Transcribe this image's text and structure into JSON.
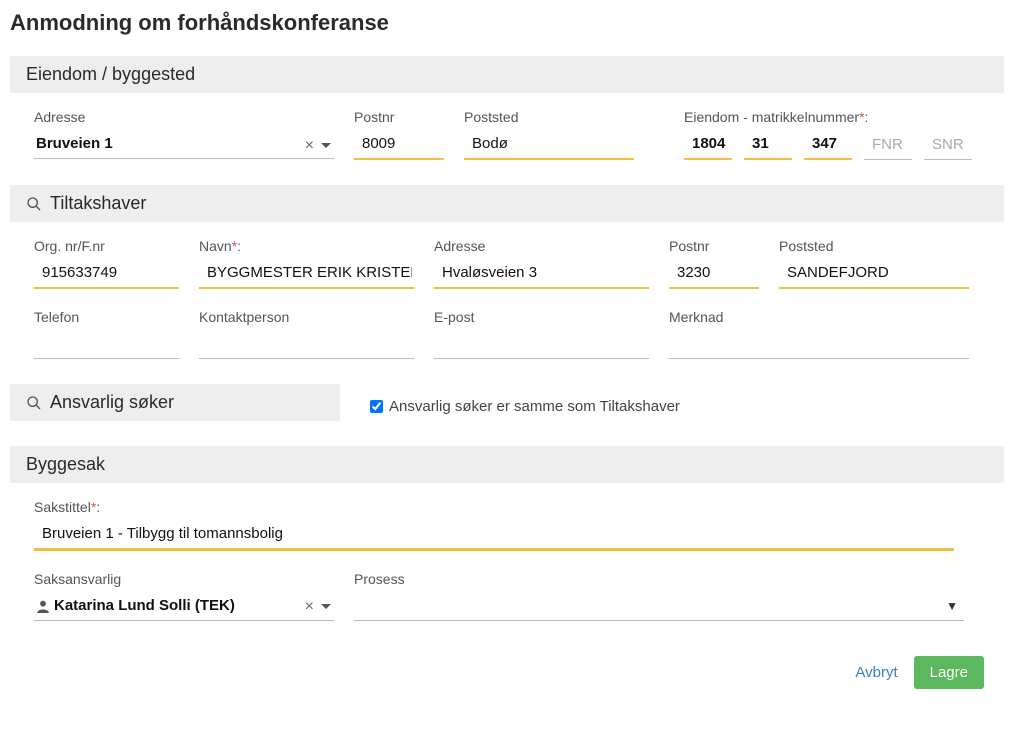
{
  "page_title": "Anmodning om forhåndskonferanse",
  "sections": {
    "eiendom": {
      "header": "Eiendom / byggested",
      "fields": {
        "adresse_label": "Adresse",
        "adresse_value": "Bruveien 1",
        "postnr_label": "Postnr",
        "postnr_value": "8009",
        "poststed_label": "Poststed",
        "poststed_value": "Bodø",
        "matrikkel_label": "Eiendom - matrikkelnummer",
        "matrikkel": {
          "knr": "1804",
          "gnr": "31",
          "bnr": "347",
          "fnr_ph": "FNR",
          "snr_ph": "SNR"
        }
      }
    },
    "tiltakshaver": {
      "header": "Tiltakshaver",
      "fields": {
        "org_label": "Org. nr/F.nr",
        "org_value": "915633749",
        "navn_label": "Navn",
        "navn_value": "BYGGMESTER ERIK KRISTER AS",
        "adresse_label": "Adresse",
        "adresse_value": "Hvaløsveien 3",
        "postnr_label": "Postnr",
        "postnr_value": "3230",
        "poststed_label": "Poststed",
        "poststed_value": "SANDEFJORD",
        "telefon_label": "Telefon",
        "telefon_value": "",
        "kontakt_label": "Kontaktperson",
        "kontakt_value": "",
        "epost_label": "E-post",
        "epost_value": "",
        "merknad_label": "Merknad",
        "merknad_value": ""
      }
    },
    "ansvarlig": {
      "header": "Ansvarlig søker",
      "same_checkbox_label": "Ansvarlig søker er samme som Tiltakshaver",
      "same_checked": true
    },
    "byggesak": {
      "header": "Byggesak",
      "fields": {
        "sakstittel_label": "Sakstittel",
        "sakstittel_value": "Bruveien 1 - Tilbygg til tomannsbolig",
        "saksansvarlig_label": "Saksansvarlig",
        "saksansvarlig_value": "Katarina Lund Solli (TEK)",
        "prosess_label": "Prosess",
        "prosess_value": ""
      }
    }
  },
  "footer": {
    "cancel": "Avbryt",
    "save": "Lagre"
  },
  "required_marker": "*",
  "required_colon": ":"
}
